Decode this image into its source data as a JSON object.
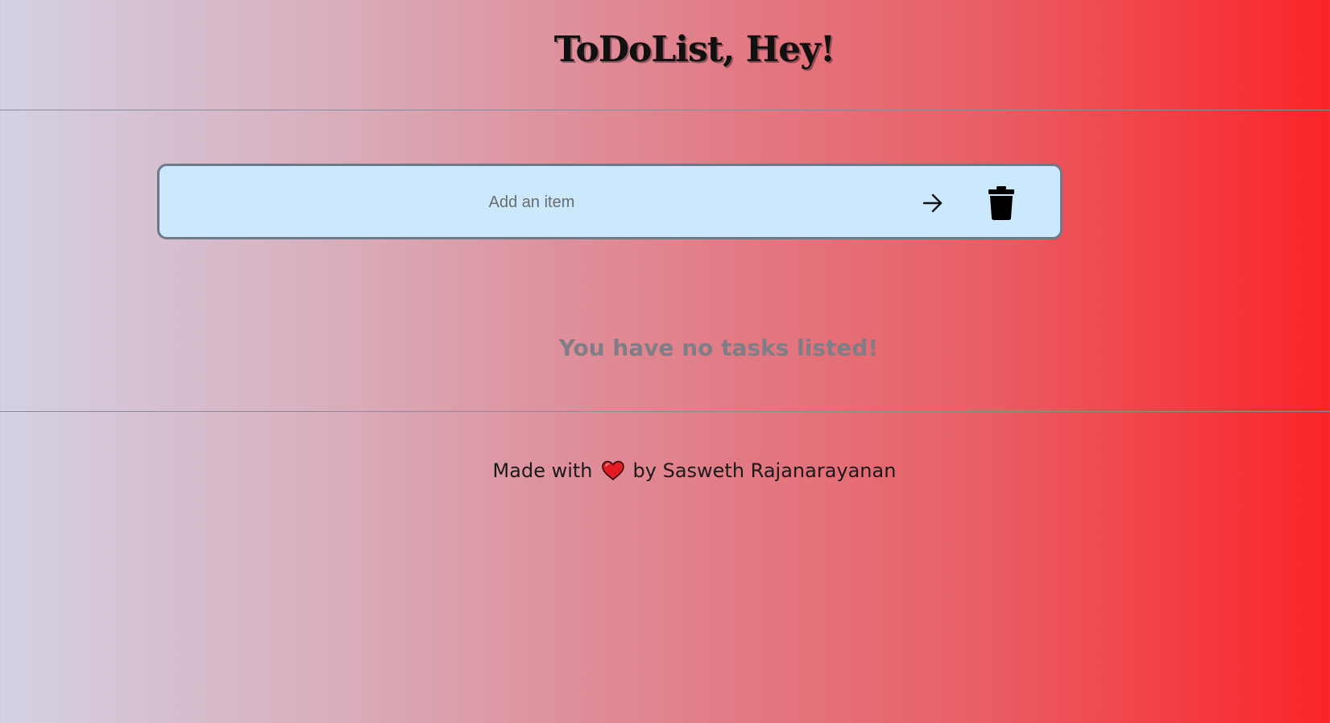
{
  "header": {
    "title": "ToDoList, Hey!"
  },
  "input_bar": {
    "placeholder": "Add an item",
    "value": "",
    "add_icon": "arrow-right-icon",
    "delete_icon": "trash-icon"
  },
  "tasks": {
    "empty_message": "You have no tasks listed!"
  },
  "footer": {
    "prefix": "Made with",
    "heart_icon": "heart-icon",
    "suffix": "by Sasweth Rajanarayanan"
  },
  "colors": {
    "gradient_start": "#d3d1e3",
    "gradient_end": "#fa2428",
    "input_background": "#cbe8fd",
    "input_border": "#6b7a88",
    "empty_message": "#7e7e86",
    "heart": "#e41b23"
  }
}
